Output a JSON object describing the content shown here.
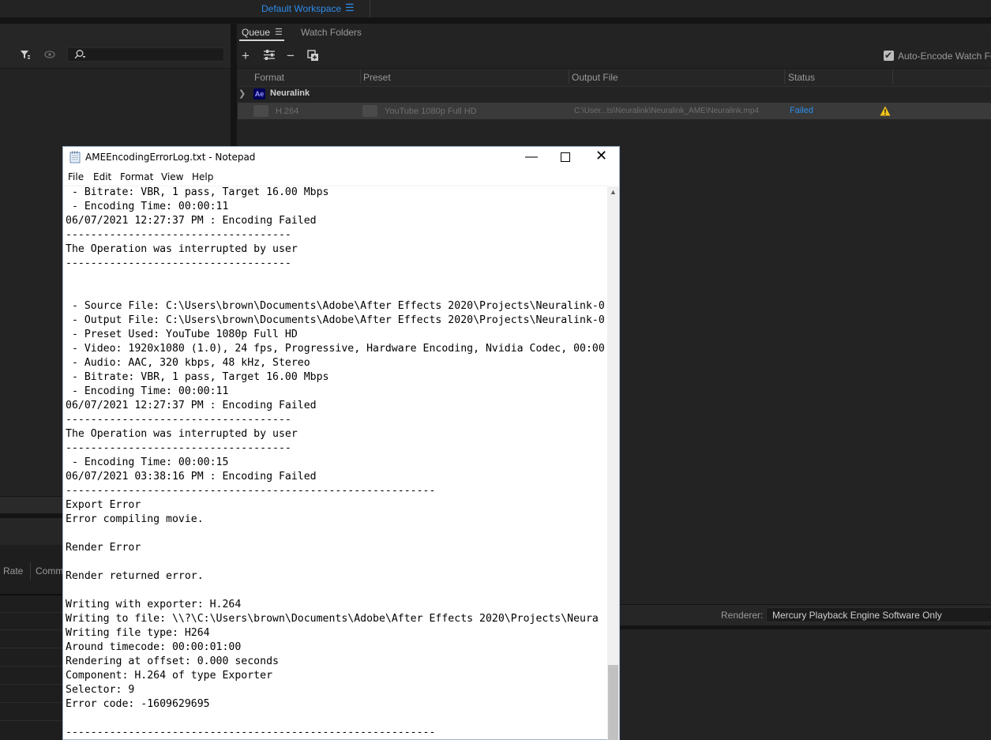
{
  "ame": {
    "workspace": "Default Workspace",
    "tabs": [
      "Queue",
      "Watch Folders"
    ],
    "auto_encode_label": "Auto-Encode Watch Folders",
    "columns": [
      "Format",
      "Preset",
      "Output File",
      "Status"
    ],
    "group_badge": "Ae",
    "group_name": "Neuralink",
    "job": {
      "format": "H.264",
      "preset": "YouTube 1080p Full HD",
      "output": "C:\\User...ts\\Neuralink\\Neuralink_AME\\Neuralink.mp4",
      "status": "Failed"
    },
    "lower_columns": [
      "Rate",
      "Comm"
    ],
    "renderer_label": "Renderer:",
    "renderer_value": "Mercury Playback Engine Software Only",
    "colors": {
      "accent": "#2d8ceb",
      "warning": "#f5c518",
      "ae_badge": "#00005b"
    }
  },
  "notepad": {
    "title": "AMEEncodingErrorLog.txt - Notepad",
    "menu": [
      "File",
      "Edit",
      "Format",
      "View",
      "Help"
    ],
    "lines": [
      " - Bitrate: VBR, 1 pass, Target 16.00 Mbps",
      " - Encoding Time: 00:00:11",
      "06/07/2021 12:27:37 PM : Encoding Failed",
      "------------------------------------",
      "The Operation was interrupted by user",
      "------------------------------------",
      "",
      "",
      " - Source File: C:\\Users\\brown\\Documents\\Adobe\\After Effects 2020\\Projects\\Neuralink-0",
      " - Output File: C:\\Users\\brown\\Documents\\Adobe\\After Effects 2020\\Projects\\Neuralink-0",
      " - Preset Used: YouTube 1080p Full HD",
      " - Video: 1920x1080 (1.0), 24 fps, Progressive, Hardware Encoding, Nvidia Codec, 00:00",
      " - Audio: AAC, 320 kbps, 48 kHz, Stereo",
      " - Bitrate: VBR, 1 pass, Target 16.00 Mbps",
      " - Encoding Time: 00:00:11",
      "06/07/2021 12:27:37 PM : Encoding Failed",
      "------------------------------------",
      "The Operation was interrupted by user",
      "------------------------------------",
      " - Encoding Time: 00:00:15",
      "06/07/2021 03:38:16 PM : Encoding Failed",
      "-----------------------------------------------------------",
      "Export Error",
      "Error compiling movie.",
      "",
      "Render Error",
      "",
      "Render returned error.",
      "",
      "Writing with exporter: H.264",
      "Writing to file: \\\\?\\C:\\Users\\brown\\Documents\\Adobe\\After Effects 2020\\Projects\\Neura",
      "Writing file type: H264",
      "Around timecode: 00:00:01:00",
      "Rendering at offset: 0.000 seconds",
      "Component: H.264 of type Exporter",
      "Selector: 9",
      "Error code: -1609629695",
      "",
      "-----------------------------------------------------------"
    ]
  }
}
